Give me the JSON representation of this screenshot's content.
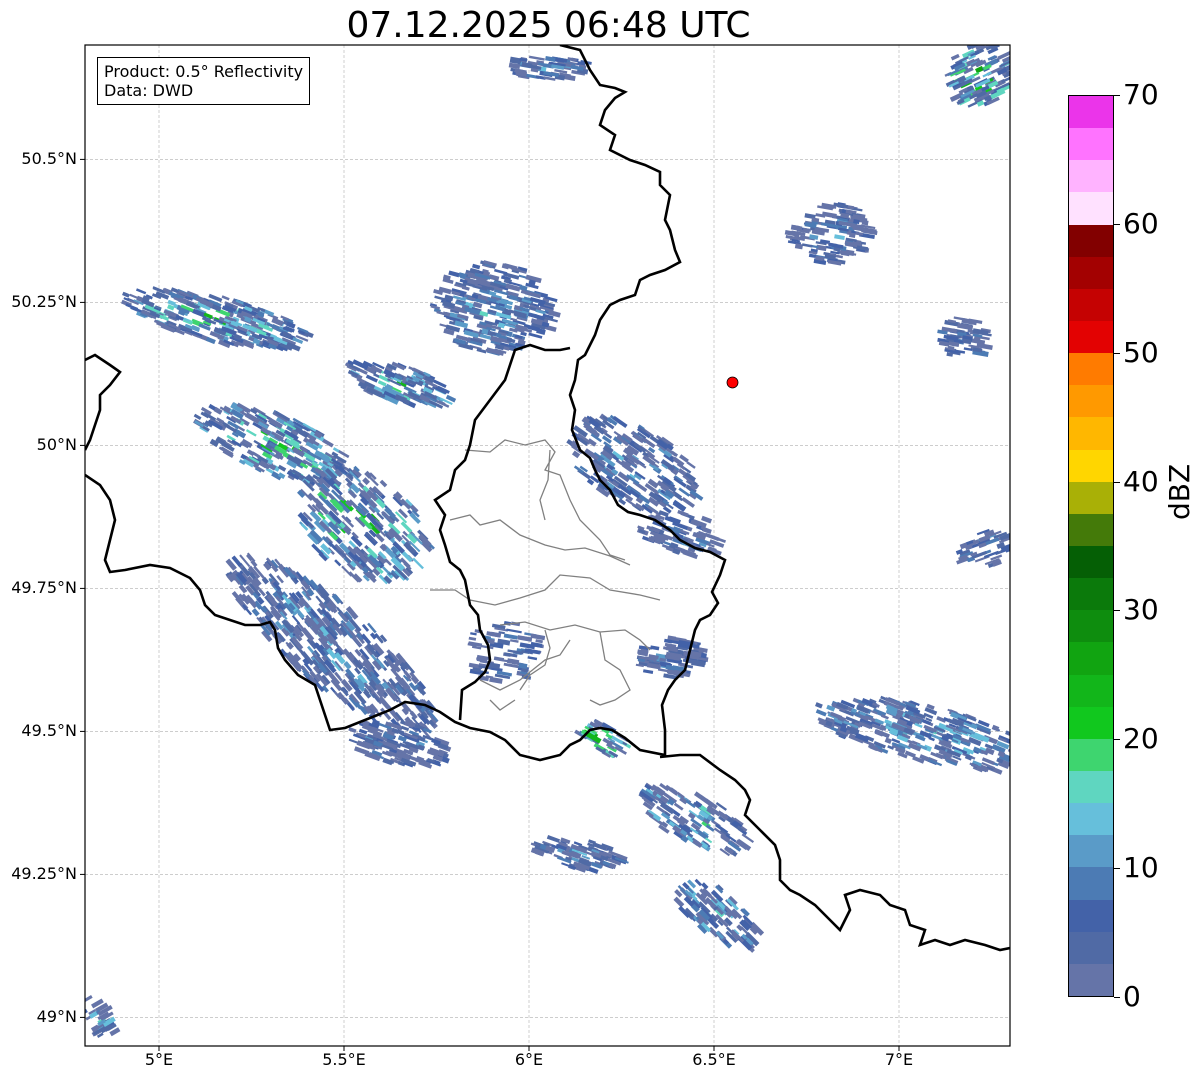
{
  "title": "07.12.2025 06:48 UTC",
  "info": {
    "product": "Product: 0.5° Reflectivity",
    "data": "Data: DWD"
  },
  "axes": {
    "lat_labels": [
      {
        "value": 50.5,
        "text": "50.5°N"
      },
      {
        "value": 50.25,
        "text": "50.25°N"
      },
      {
        "value": 50.0,
        "text": "50°N"
      },
      {
        "value": 49.75,
        "text": "49.75°N"
      },
      {
        "value": 49.5,
        "text": "49.5°N"
      },
      {
        "value": 49.25,
        "text": "49.25°N"
      },
      {
        "value": 49.0,
        "text": "49°N"
      }
    ],
    "lon_labels": [
      {
        "value": 5.0,
        "text": "5°E"
      },
      {
        "value": 5.5,
        "text": "5.5°E"
      },
      {
        "value": 6.0,
        "text": "6°E"
      },
      {
        "value": 6.5,
        "text": "6.5°E"
      },
      {
        "value": 7.0,
        "text": "7°E"
      }
    ],
    "lon_range": [
      4.8,
      7.3
    ],
    "lat_range": [
      48.95,
      50.7
    ],
    "grid": true
  },
  "colorbar": {
    "label": "dBZ",
    "ticks": [
      "0",
      "10",
      "20",
      "30",
      "40",
      "50",
      "60",
      "70"
    ],
    "min": 0,
    "max": 70,
    "step": 2.5,
    "colors": [
      "#6574a8",
      "#506aa5",
      "#4362a8",
      "#4c7bb4",
      "#5a9bc8",
      "#66bfdb",
      "#5fd6c0",
      "#3ed56f",
      "#11c81e",
      "#12b61a",
      "#11a411",
      "#0e8d0e",
      "#0b7a0b",
      "#055f05",
      "#447a09",
      "#a9b006",
      "#ffd600",
      "#ffb700",
      "#ff9900",
      "#ff7b00",
      "#e30202",
      "#c50202",
      "#a30101",
      "#820000",
      "#ffe1ff",
      "#ffb3ff",
      "#ff73ff",
      "#eb34ea"
    ]
  },
  "marker": {
    "lon": 6.55,
    "lat": 50.11,
    "color": "#ff0000"
  },
  "legend_colors": {
    "border": "#000000",
    "province": "#808080",
    "grid": "#b0b0b0"
  }
}
